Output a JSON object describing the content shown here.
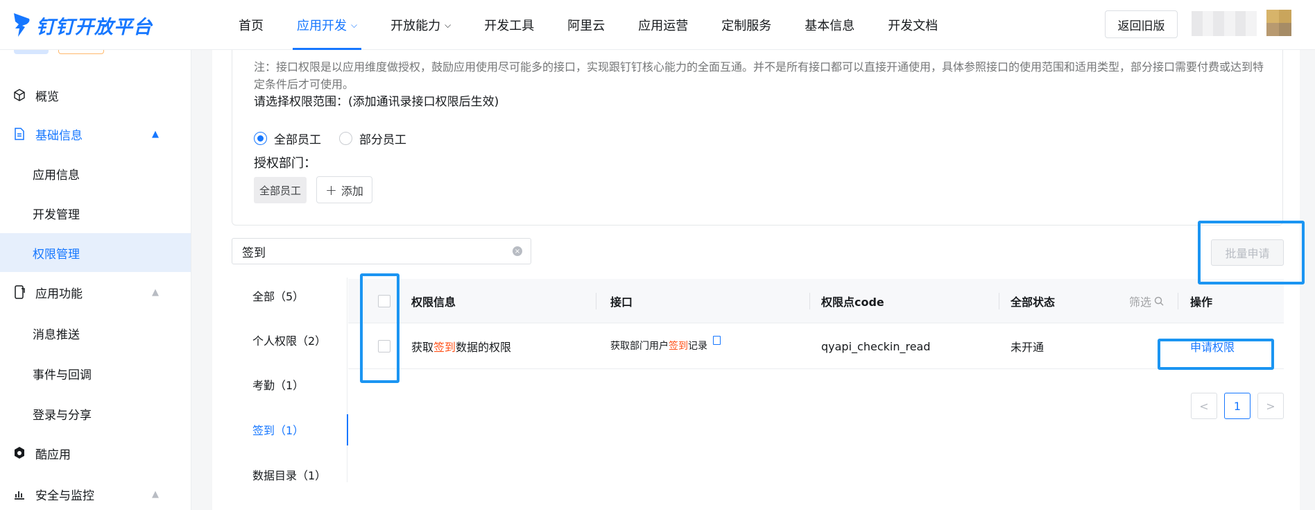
{
  "brand": {
    "name": "钉钉开放平台"
  },
  "nav": {
    "items": [
      {
        "label": "首页"
      },
      {
        "label": "应用开发",
        "caret": "⌵"
      },
      {
        "label": "开放能力",
        "caret": "⌵"
      },
      {
        "label": "开发工具"
      },
      {
        "label": "阿里云"
      },
      {
        "label": "应用运营"
      },
      {
        "label": "定制服务"
      },
      {
        "label": "基本信息"
      },
      {
        "label": "开发文档"
      }
    ],
    "active_index": 1,
    "old_version_label": "返回旧版"
  },
  "sidebar": {
    "items": [
      {
        "label": "概览",
        "icon": "cube-icon"
      },
      {
        "label": "基础信息",
        "icon": "document-icon",
        "arrow": "▲"
      },
      {
        "label": "应用信息"
      },
      {
        "label": "开发管理"
      },
      {
        "label": "权限管理"
      },
      {
        "label": "应用功能",
        "icon": "phone-icon",
        "arrow": "▲"
      },
      {
        "label": "消息推送"
      },
      {
        "label": "事件与回调"
      },
      {
        "label": "登录与分享"
      },
      {
        "label": "酷应用",
        "icon": "cool-app-icon"
      },
      {
        "label": "安全与监控",
        "icon": "chart-icon",
        "arrow": "▲"
      }
    ]
  },
  "permission_scope": {
    "note": "注：接口权限是以应用维度做授权，鼓励应用使用尽可能多的接口，实现跟钉钉核心能力的全面互通。并不是所有接口都可以直接开通使用，具体参照接口的使用范围和适用类型，部分接口需要付费或达到特定条件后才可使用。",
    "title": "请选择权限范围：(添加通讯录接口权限后生效)",
    "options": [
      {
        "label": "全部员工",
        "selected": true
      },
      {
        "label": "部分员工",
        "selected": false
      }
    ],
    "dept_title": "授权部门：",
    "dept_tag": "全部员工",
    "add_label": "添加"
  },
  "search": {
    "value": "签到"
  },
  "batch_button": "批量申请",
  "categories": [
    {
      "label": "全部（5）"
    },
    {
      "label": "个人权限（2）"
    },
    {
      "label": "考勤（1）"
    },
    {
      "label": "签到（1）"
    },
    {
      "label": "数据目录（1）"
    }
  ],
  "active_category": 3,
  "table": {
    "headers": {
      "info": "权限信息",
      "api": "接口",
      "code": "权限点code",
      "status": "全部状态",
      "filter": "筛选",
      "action": "操作"
    },
    "rows": [
      {
        "info_pre": "获取",
        "info_hl": "签到",
        "info_post": "数据的权限",
        "api_pre": "获取部门用户",
        "api_hl": "签到",
        "api_post": "记录",
        "code": "qyapi_checkin_read",
        "status": "未开通",
        "action": "申请权限"
      }
    ]
  },
  "pagination": {
    "prev": "<",
    "current": "1",
    "next": ">"
  },
  "colors": {
    "accent": "#1677ff",
    "highlight": "#ff5219",
    "annotation": "#1b95f2"
  }
}
